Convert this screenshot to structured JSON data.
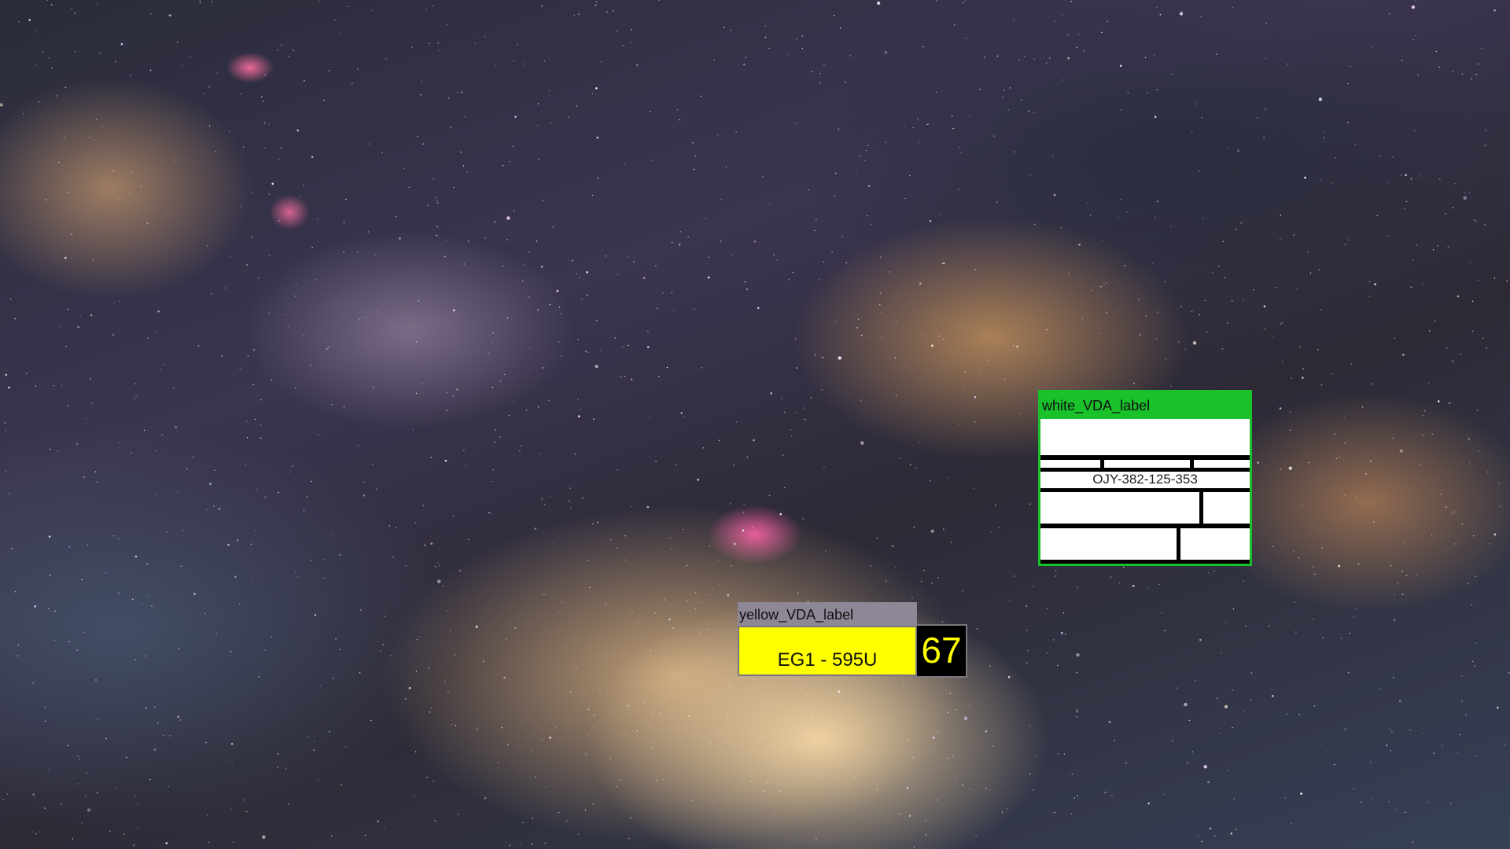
{
  "white_label": {
    "title": "white_VDA_label",
    "code": "OJY-382-125-353"
  },
  "yellow_label": {
    "title": "yellow_VDA_label",
    "plate": "EG1 - 595U",
    "number": "67"
  },
  "colors": {
    "white_label_accent": "#19c12a",
    "yellow_label_fill": "#ffff00",
    "yellow_label_header": "#8d8796"
  }
}
